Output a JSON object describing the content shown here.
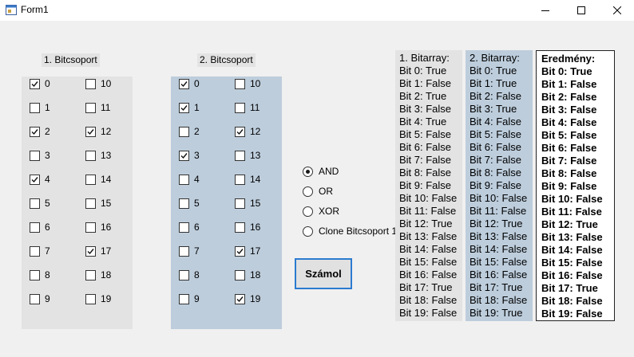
{
  "window": {
    "title": "Form1",
    "controls": [
      "minimize-icon",
      "maximize-icon",
      "close-icon"
    ]
  },
  "colors": {
    "panel1_bg": "#e3e3e3",
    "panel2_bg": "#bdcddc",
    "list2_bg": "#bdcddc",
    "button_border": "#2b7bd0"
  },
  "group1": {
    "label": "1. Bitcsoport",
    "checkboxes": [
      {
        "label": "0",
        "checked": true
      },
      {
        "label": "1",
        "checked": false
      },
      {
        "label": "2",
        "checked": true
      },
      {
        "label": "3",
        "checked": false
      },
      {
        "label": "4",
        "checked": true
      },
      {
        "label": "5",
        "checked": false
      },
      {
        "label": "6",
        "checked": false
      },
      {
        "label": "7",
        "checked": false
      },
      {
        "label": "8",
        "checked": false
      },
      {
        "label": "9",
        "checked": false
      },
      {
        "label": "10",
        "checked": false
      },
      {
        "label": "11",
        "checked": false
      },
      {
        "label": "12",
        "checked": true
      },
      {
        "label": "13",
        "checked": false
      },
      {
        "label": "14",
        "checked": false
      },
      {
        "label": "15",
        "checked": false
      },
      {
        "label": "16",
        "checked": false
      },
      {
        "label": "17",
        "checked": true
      },
      {
        "label": "18",
        "checked": false
      },
      {
        "label": "19",
        "checked": false
      }
    ]
  },
  "group2": {
    "label": "2. Bitcsoport",
    "checkboxes": [
      {
        "label": "0",
        "checked": true
      },
      {
        "label": "1",
        "checked": true
      },
      {
        "label": "2",
        "checked": false
      },
      {
        "label": "3",
        "checked": true
      },
      {
        "label": "4",
        "checked": false
      },
      {
        "label": "5",
        "checked": false
      },
      {
        "label": "6",
        "checked": false
      },
      {
        "label": "7",
        "checked": false
      },
      {
        "label": "8",
        "checked": false
      },
      {
        "label": "9",
        "checked": false
      },
      {
        "label": "10",
        "checked": false
      },
      {
        "label": "11",
        "checked": false
      },
      {
        "label": "12",
        "checked": true
      },
      {
        "label": "13",
        "checked": false
      },
      {
        "label": "14",
        "checked": false
      },
      {
        "label": "15",
        "checked": false
      },
      {
        "label": "16",
        "checked": false
      },
      {
        "label": "17",
        "checked": true
      },
      {
        "label": "18",
        "checked": false
      },
      {
        "label": "19",
        "checked": true
      }
    ]
  },
  "operations": [
    {
      "label": "AND",
      "selected": true
    },
    {
      "label": "OR",
      "selected": false
    },
    {
      "label": "XOR",
      "selected": false
    },
    {
      "label": "Clone Bitcsoport 1",
      "selected": false
    }
  ],
  "calculate_button": "Számol",
  "lists": {
    "list1": [
      "1. Bitarray:",
      "Bit 0: True",
      "Bit 1: False",
      "Bit 2: True",
      "Bit 3: False",
      "Bit 4: True",
      "Bit 5: False",
      "Bit 6: False",
      "Bit 7: False",
      "Bit 8: False",
      "Bit 9: False",
      "Bit 10: False",
      "Bit 11: False",
      "Bit 12: True",
      "Bit 13: False",
      "Bit 14: False",
      "Bit 15: False",
      "Bit 16: False",
      "Bit 17: True",
      "Bit 18: False",
      "Bit 19: False"
    ],
    "list2": [
      "2. Bitarray:",
      "Bit 0: True",
      "Bit 1: True",
      "Bit 2: False",
      "Bit 3: True",
      "Bit 4: False",
      "Bit 5: False",
      "Bit 6: False",
      "Bit 7: False",
      "Bit 8: False",
      "Bit 9: False",
      "Bit 10: False",
      "Bit 11: False",
      "Bit 12: True",
      "Bit 13: False",
      "Bit 14: False",
      "Bit 15: False",
      "Bit 16: False",
      "Bit 17: True",
      "Bit 18: False",
      "Bit 19: True"
    ],
    "result": [
      "Eredmény:",
      "Bit 0: True",
      "Bit 1: False",
      "Bit 2: False",
      "Bit 3: False",
      "Bit 4: False",
      "Bit 5: False",
      "Bit 6: False",
      "Bit 7: False",
      "Bit 8: False",
      "Bit 9: False",
      "Bit 10: False",
      "Bit 11: False",
      "Bit 12: True",
      "Bit 13: False",
      "Bit 14: False",
      "Bit 15: False",
      "Bit 16: False",
      "Bit 17: True",
      "Bit 18: False",
      "Bit 19: False"
    ]
  }
}
